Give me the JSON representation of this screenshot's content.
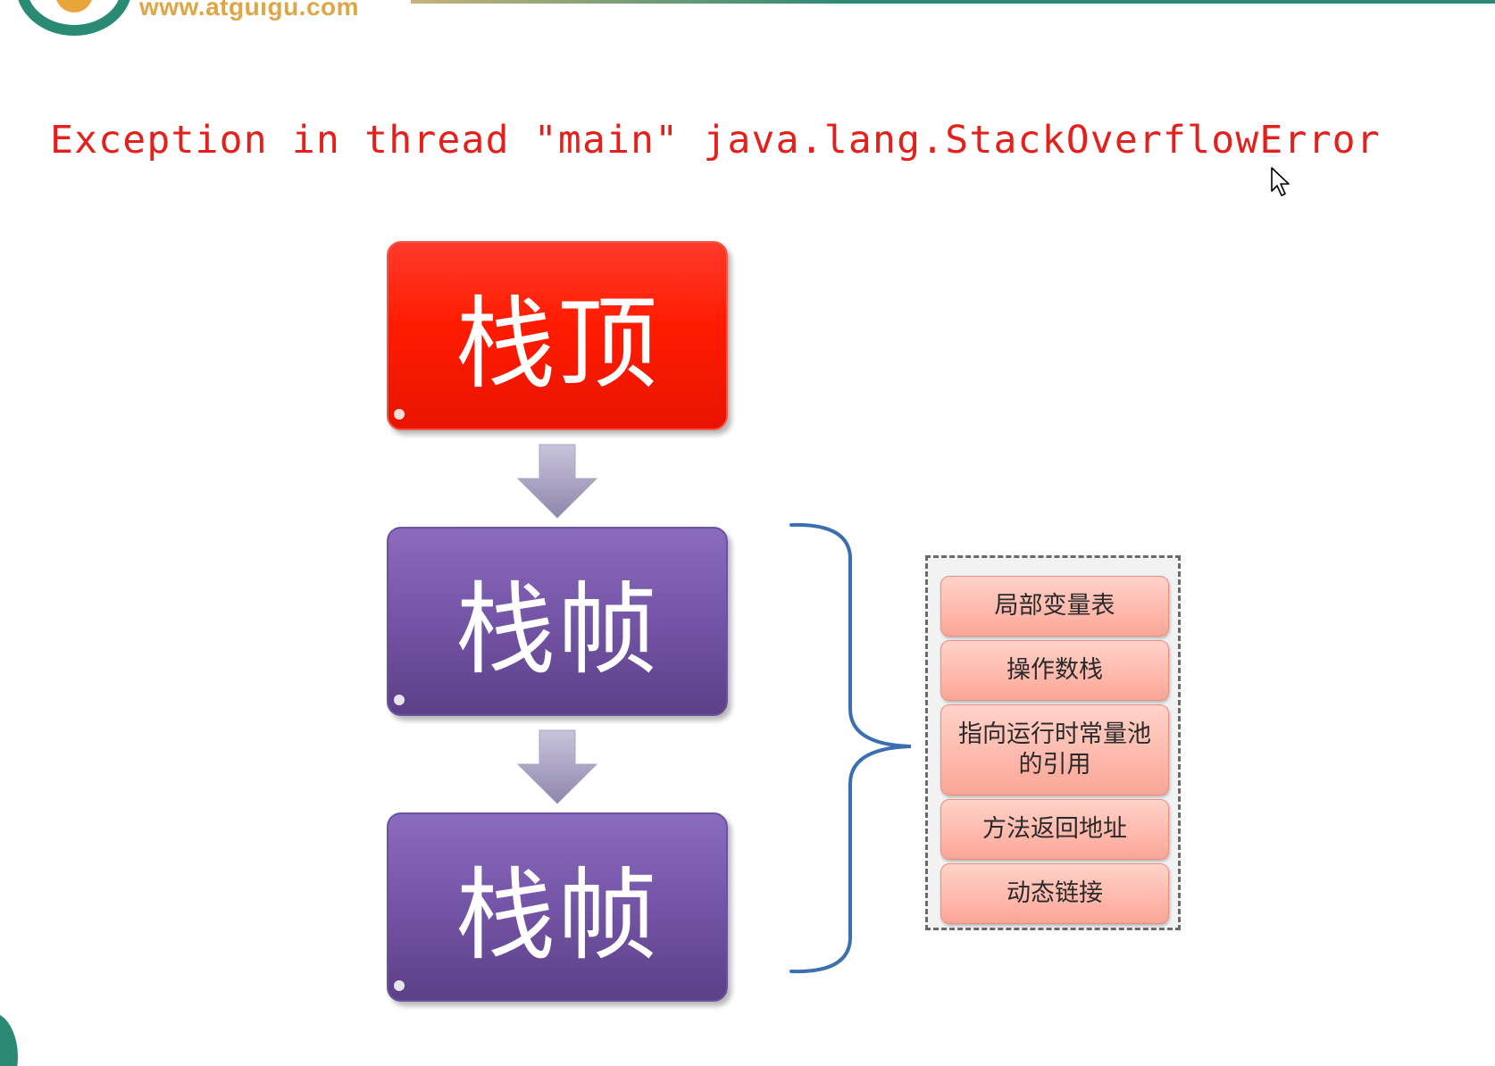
{
  "header": {
    "logo_url": "www.atguigu.com"
  },
  "title": {
    "text": "Exception in thread \"main\" java.lang.StackOverflowError"
  },
  "stack": {
    "top_label": "栈顶",
    "frames": [
      {
        "label": "栈帧"
      },
      {
        "label": "栈帧"
      }
    ]
  },
  "frame_details": {
    "items": [
      {
        "label": "局部变量表"
      },
      {
        "label": "操作数栈"
      },
      {
        "label": "指向运行时常量池的引用"
      },
      {
        "label": "方法返回地址"
      },
      {
        "label": "动态链接"
      }
    ]
  },
  "colors": {
    "title_red": "#e3201b",
    "stack_top_red": "#ff1b00",
    "stack_frame_purple": "#7454a6",
    "detail_pink": "#ffb8ab",
    "bracket_blue": "#3a6fb0",
    "brand_green": "#2a8a74",
    "brand_orange": "#e0a545"
  }
}
